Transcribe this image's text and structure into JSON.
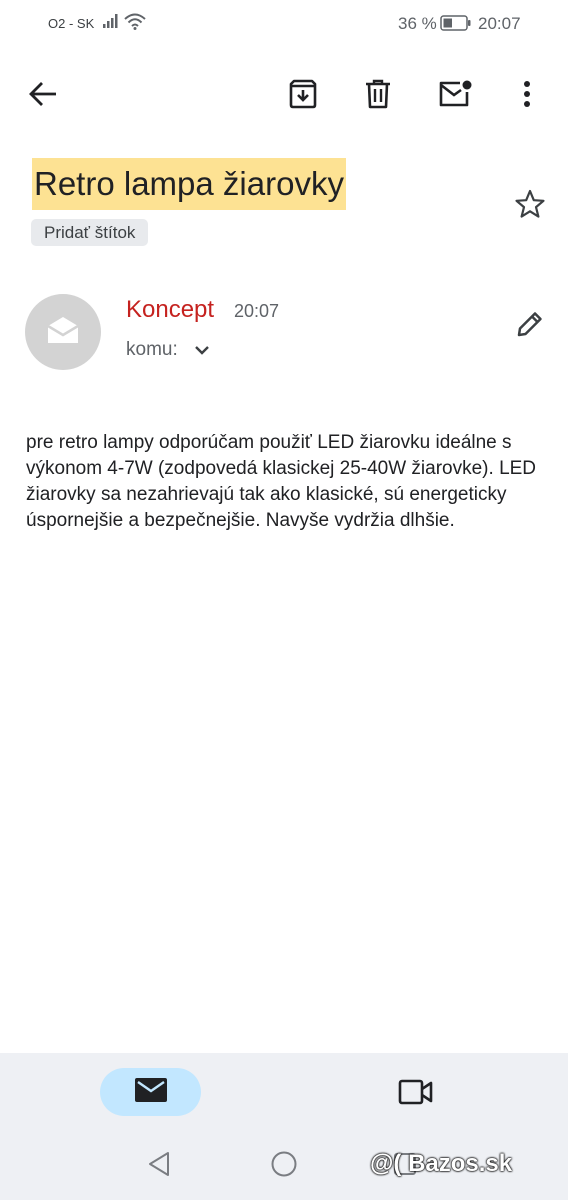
{
  "status_bar": {
    "carrier": "O2 - SK",
    "battery_percent": "36 %",
    "time": "20:07",
    "icons": [
      "signal-icon",
      "wifi-icon",
      "battery-icon"
    ]
  },
  "toolbar": {
    "icons": [
      "back-arrow-icon",
      "archive-icon",
      "trash-icon",
      "mark-unread-icon",
      "more-vert-icon"
    ]
  },
  "email": {
    "subject": "Retro lampa žiarovky",
    "label_chip": "Pridať štítok",
    "sender": "Koncept",
    "time": "20:07",
    "to_label": "komu:",
    "body": "pre retro lampy odporúčam použiť LED žiarovku ideálne s výkonom 4-7W (zodpovedá klasickej 25-40W žiarovke). LED žiarovky sa nezahrievajú tak ako klasické, sú energeticky úspornejšie a bezpečnejšie. Navyše vydržia dlhšie."
  },
  "bottom_nav": {
    "items": [
      "mail-icon",
      "video-camera-icon"
    ],
    "selected": "mail-icon"
  },
  "system_nav": [
    "back-triangle-icon",
    "home-circle-icon",
    "recents-square-icon"
  ],
  "watermark": "@( Bazos.sk",
  "colors": {
    "subject_highlight": "#fde293",
    "sender": "#c5221f",
    "chip_bg": "#e8eaed",
    "bottom_bar_bg": "#eef0f4",
    "nav_selected_bg": "#c2e7ff"
  }
}
